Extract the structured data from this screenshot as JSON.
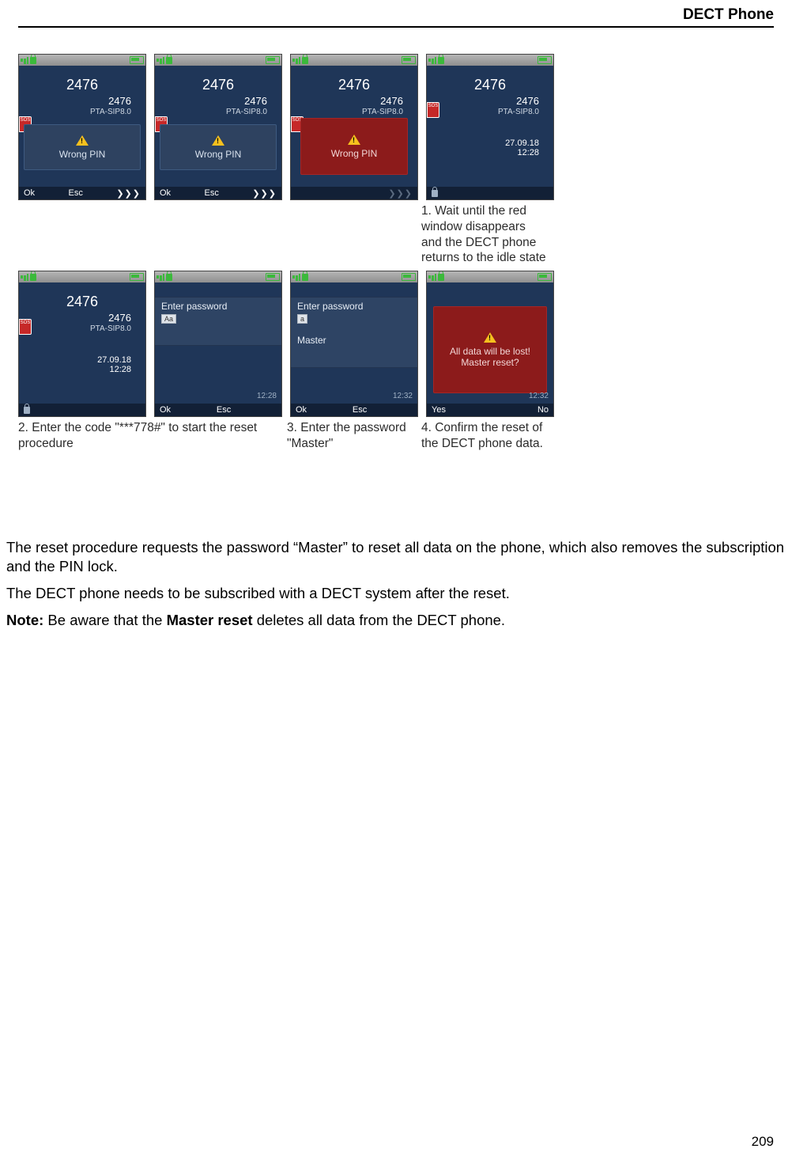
{
  "header": {
    "title": "DECT Phone"
  },
  "page_number": "209",
  "common": {
    "number_large": "2476",
    "number_small": "2476",
    "ptasip": "PTA-SIP8.0",
    "date": "27.09.18",
    "time": "12:28",
    "sos": "SOS",
    "wrong_pin": "Wrong PIN",
    "ok": "Ok",
    "esc": "Esc",
    "fwd": "❯❯❯",
    "yes": "Yes",
    "no": "No"
  },
  "row1": {
    "s1": {
      "softkeys": true
    },
    "s2": {
      "softkeys": true
    },
    "s3": {
      "softkeys_fwd_only": true
    },
    "s4": {
      "idle": true
    }
  },
  "row2": {
    "col1": {
      "caption": "2. Enter the code \"***778#\"  to start the reset procedure"
    },
    "col2": {
      "enter_password": "Enter password",
      "mode": "Aa",
      "time": "12:28"
    },
    "col3": {
      "enter_password": "Enter password",
      "mode": "a",
      "value": "Master",
      "time": "12:32",
      "caption": "3. Enter the password  \"Master\""
    },
    "col4": {
      "line1": "All data will be lost!",
      "line2": "Master reset?",
      "time": "12:32",
      "caption_above": "1. Wait until the  red  window disappears  and the DECT phone  returns  to the idle  state",
      "caption_below": "4. Confirm  the reset of the DECT phone  data."
    }
  },
  "body": {
    "p1": "The reset procedure requests the password “Master” to reset all data on the phone, which also removes the subscription and the PIN lock.",
    "p2": "The DECT phone needs to be subscribed with a DECT system after the reset.",
    "p3_a": "Note:",
    "p3_b": " Be aware that the ",
    "p3_c": "Master reset",
    "p3_d": " deletes all data from the DECT phone."
  }
}
